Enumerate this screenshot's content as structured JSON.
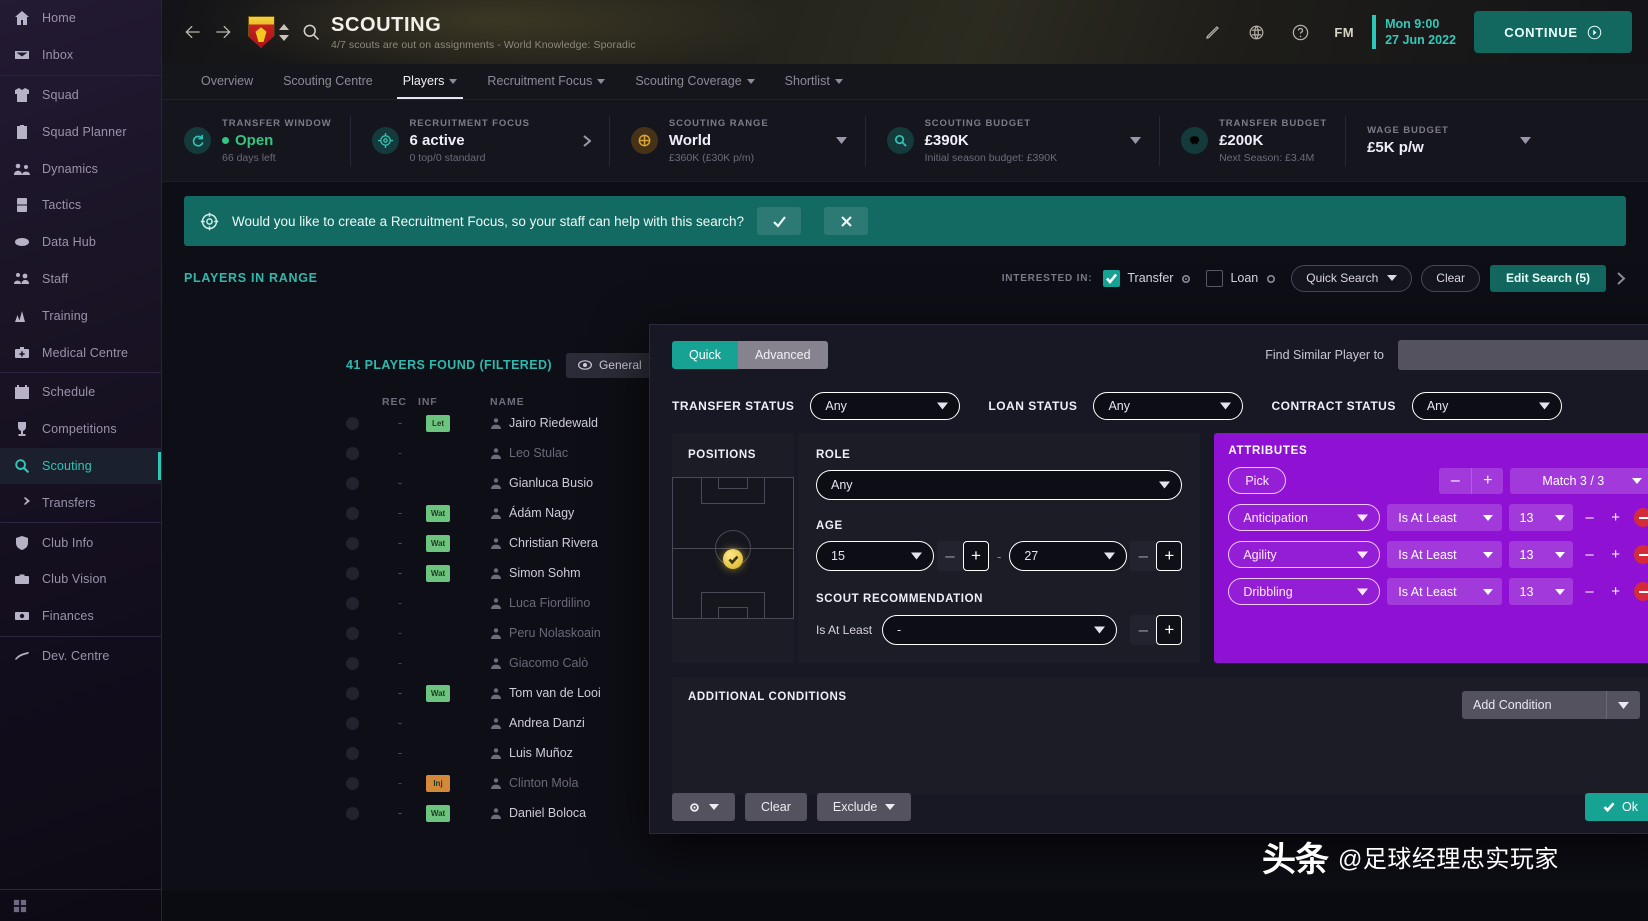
{
  "sidebar": {
    "items": [
      {
        "label": "Home",
        "icon": "home-icon"
      },
      {
        "label": "Inbox",
        "icon": "inbox-icon"
      },
      {
        "label": "Squad",
        "icon": "shirt-icon"
      },
      {
        "label": "Squad Planner",
        "icon": "clipboard-icon"
      },
      {
        "label": "Dynamics",
        "icon": "people-icon"
      },
      {
        "label": "Tactics",
        "icon": "tactics-icon"
      },
      {
        "label": "Data Hub",
        "icon": "datahub-icon"
      },
      {
        "label": "Staff",
        "icon": "staff-icon"
      },
      {
        "label": "Training",
        "icon": "training-icon"
      },
      {
        "label": "Medical Centre",
        "icon": "medical-icon"
      },
      {
        "label": "Schedule",
        "icon": "calendar-icon"
      },
      {
        "label": "Competitions",
        "icon": "trophy-icon"
      },
      {
        "label": "Scouting",
        "icon": "magnifier-icon",
        "active": true
      },
      {
        "label": "Transfers",
        "icon": "transfer-icon"
      },
      {
        "label": "Club Info",
        "icon": "shield-icon"
      },
      {
        "label": "Club Vision",
        "icon": "briefcase-icon"
      },
      {
        "label": "Finances",
        "icon": "money-icon"
      },
      {
        "label": "Dev. Centre",
        "icon": "dev-icon"
      }
    ]
  },
  "header": {
    "back_icon": "back-arrow-icon",
    "forward_icon": "forward-arrow-icon",
    "badge_icon": "watford-club-badge",
    "search_icon": "search-icon",
    "title": "SCOUTING",
    "subtitle": "4/7 scouts are out on assignments - World Knowledge: Sporadic",
    "edit_icon": "pencil-icon",
    "globe_icon": "social-icon",
    "help_icon": "help-icon",
    "fm_label": "FM",
    "date_time": "Mon 9:00",
    "date_day": "27 Jun 2022",
    "continue_label": "CONTINUE",
    "continue_icon": "arrow-right-circle-icon",
    "accent_teal": "#2ec6b6"
  },
  "tabs": [
    {
      "label": "Overview",
      "dropdown": false,
      "active": false
    },
    {
      "label": "Scouting Centre",
      "dropdown": false,
      "active": false
    },
    {
      "label": "Players",
      "dropdown": true,
      "active": true
    },
    {
      "label": "Recruitment Focus",
      "dropdown": true,
      "active": false
    },
    {
      "label": "Scouting Coverage",
      "dropdown": true,
      "active": false
    },
    {
      "label": "Shortlist",
      "dropdown": true,
      "active": false
    }
  ],
  "status_strip": [
    {
      "label": "TRANSFER WINDOW",
      "value": "Open",
      "sub": "66 days left",
      "icon": "refresh-icon",
      "icon_color": "teal",
      "value_state": "open",
      "chevron": null
    },
    {
      "label": "RECRUITMENT FOCUS",
      "value": "6 active",
      "sub": "0 top/0 standard",
      "icon": "target-icon",
      "icon_color": "teal",
      "chevron": "right"
    },
    {
      "label": "SCOUTING RANGE",
      "value": "World",
      "sub": "£360K (£30K p/m)",
      "icon": "globe-range-icon",
      "icon_color": "gold",
      "chevron": "down"
    },
    {
      "label": "SCOUTING BUDGET",
      "value": "£390K",
      "sub": "Initial season budget: £390K",
      "icon": "magnifier-icon",
      "icon_color": "teal",
      "chevron": "down"
    },
    {
      "label": "TRANSFER BUDGET",
      "value": "£200K",
      "sub": "Next Season: £3.4M",
      "icon": "piggy-icon",
      "icon_color": "teal",
      "chevron": null
    },
    {
      "label": "WAGE BUDGET",
      "value": "£5K p/w",
      "sub": "",
      "icon": null,
      "chevron": "down"
    }
  ],
  "recruitment_banner": {
    "icon": "target-banner-icon",
    "text": "Would you like to create a Recruitment Focus, so your staff can help with this search?",
    "accept_icon": "check-icon",
    "dismiss_icon": "close-icon",
    "color": "#126a62"
  },
  "players_in_range": {
    "title": "PLAYERS IN RANGE",
    "interested_label": "INTERESTED IN:",
    "transfer_label": "Transfer",
    "transfer_checked": true,
    "loan_label": "Loan",
    "loan_checked": false,
    "quick_search_label": "Quick Search",
    "clear_label": "Clear",
    "edit_search_label": "Edit Search (5)",
    "next_icon": "chevron-right-icon"
  },
  "player_table": {
    "found_label": "41 PLAYERS FOUND (FILTERED)",
    "general_label": "General",
    "general_icon": "eye-icon",
    "columns": [
      "REC",
      "INF",
      "NAME"
    ],
    "rows": [
      {
        "rec": "-",
        "inf": "Let",
        "inf_color": "green",
        "name": "Jairo Riedewald",
        "dim": false
      },
      {
        "rec": "-",
        "inf": "",
        "inf_color": "",
        "name": "Leo Stulac",
        "dim": true
      },
      {
        "rec": "-",
        "inf": "",
        "inf_color": "",
        "name": "Gianluca Busio",
        "dim": false
      },
      {
        "rec": "-",
        "inf": "Wat",
        "inf_color": "green",
        "name": "Ádám Nagy",
        "dim": false
      },
      {
        "rec": "-",
        "inf": "Wat",
        "inf_color": "green",
        "name": "Christian Rivera",
        "dim": false
      },
      {
        "rec": "-",
        "inf": "Wat",
        "inf_color": "green",
        "name": "Simon Sohm",
        "dim": false
      },
      {
        "rec": "-",
        "inf": "",
        "inf_color": "",
        "name": "Luca Fiordilino",
        "dim": true
      },
      {
        "rec": "-",
        "inf": "",
        "inf_color": "",
        "name": "Peru Nolaskoain",
        "dim": true
      },
      {
        "rec": "-",
        "inf": "",
        "inf_color": "",
        "name": "Giacomo Calò",
        "dim": true
      },
      {
        "rec": "-",
        "inf": "Wat",
        "inf_color": "green",
        "name": "Tom van de Looi",
        "dim": false
      },
      {
        "rec": "-",
        "inf": "",
        "inf_color": "",
        "name": "Andrea Danzi",
        "dim": false
      },
      {
        "rec": "-",
        "inf": "",
        "inf_color": "",
        "name": "Luis Muñoz",
        "dim": false
      },
      {
        "rec": "-",
        "inf": "Inj",
        "inf_color": "orange",
        "name": "Clinton Mola",
        "dim": true
      },
      {
        "rec": "-",
        "inf": "Wat",
        "inf_color": "green",
        "name": "Daniel Boloca",
        "dim": false
      }
    ]
  },
  "modal": {
    "mode_tabs": [
      {
        "label": "Quick",
        "active": true
      },
      {
        "label": "Advanced",
        "active": false
      }
    ],
    "find_similar_label": "Find Similar Player to",
    "find_similar_value": "",
    "find_similar_placeholder": "",
    "status_filters": [
      {
        "label": "TRANSFER STATUS",
        "value": "Any"
      },
      {
        "label": "LOAN STATUS",
        "value": "Any"
      },
      {
        "label": "CONTRACT STATUS",
        "value": "Any"
      }
    ],
    "positions": {
      "title": "POSITIONS",
      "selected_marker": "check-marker-icon"
    },
    "role": {
      "title": "ROLE",
      "value": "Any"
    },
    "age": {
      "title": "AGE",
      "min": "15",
      "max": "27",
      "separator": "-",
      "minus_label": "–",
      "plus_label": "+"
    },
    "scout_recommendation": {
      "title": "SCOUT RECOMMENDATION",
      "operator": "Is At Least",
      "value": "-",
      "minus_label": "–",
      "plus_label": "+"
    },
    "attributes": {
      "title": "ATTRIBUTES",
      "pick_label": "Pick",
      "match_minus": "–",
      "match_plus": "+",
      "match_label": "Match 3 / 3",
      "panel_color": "#8f12d4",
      "rows": [
        {
          "name": "Anticipation",
          "operator": "Is At Least",
          "value": "13"
        },
        {
          "name": "Agility",
          "operator": "Is At Least",
          "value": "13"
        },
        {
          "name": "Dribbling",
          "operator": "Is At Least",
          "value": "13"
        }
      ]
    },
    "additional_conditions": {
      "title": "ADDITIONAL CONDITIONS",
      "add_label": "Add Condition"
    },
    "footer": {
      "gear_icon": "gear-icon",
      "clear_label": "Clear",
      "exclude_label": "Exclude",
      "ok_label": "Ok",
      "ok_icon": "check-icon"
    }
  },
  "watermark": {
    "logo": "头条",
    "text": "@足球经理忠实玩家"
  }
}
